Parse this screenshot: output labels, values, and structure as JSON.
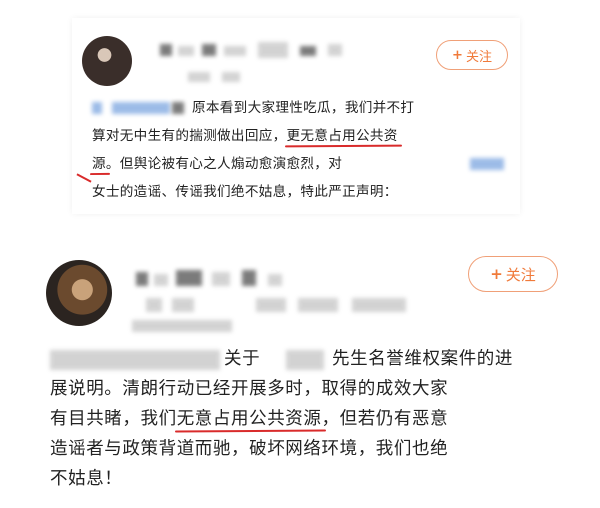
{
  "posts": [
    {
      "follow_label": "关注",
      "lines": [
        "原本看到大家理性吃瓜，我们并不打",
        "算对无中生有的揣测做出回应，",
        "更无意占用公共资",
        "源",
        "。但舆论被有心之人煽动愈演愈烈，对",
        "女士的造谣、传谣我们绝不姑息，特此严正声明："
      ]
    },
    {
      "follow_label": "关注",
      "lines": [
        "关于",
        "先生名誉维权案件的进",
        "展说明。清朗行动已经开展多时，取得的成效大家",
        "有目共睹，我们",
        "无意占用公共资源",
        "，但若仍有恶意",
        "造谣者与政策背道而驰，破坏网络环境，我们也绝",
        "不姑息！"
      ]
    }
  ],
  "icons": {
    "follow": "plus-icon"
  },
  "colors": {
    "accent": "#f07a3a",
    "underline": "#d92b2b"
  }
}
